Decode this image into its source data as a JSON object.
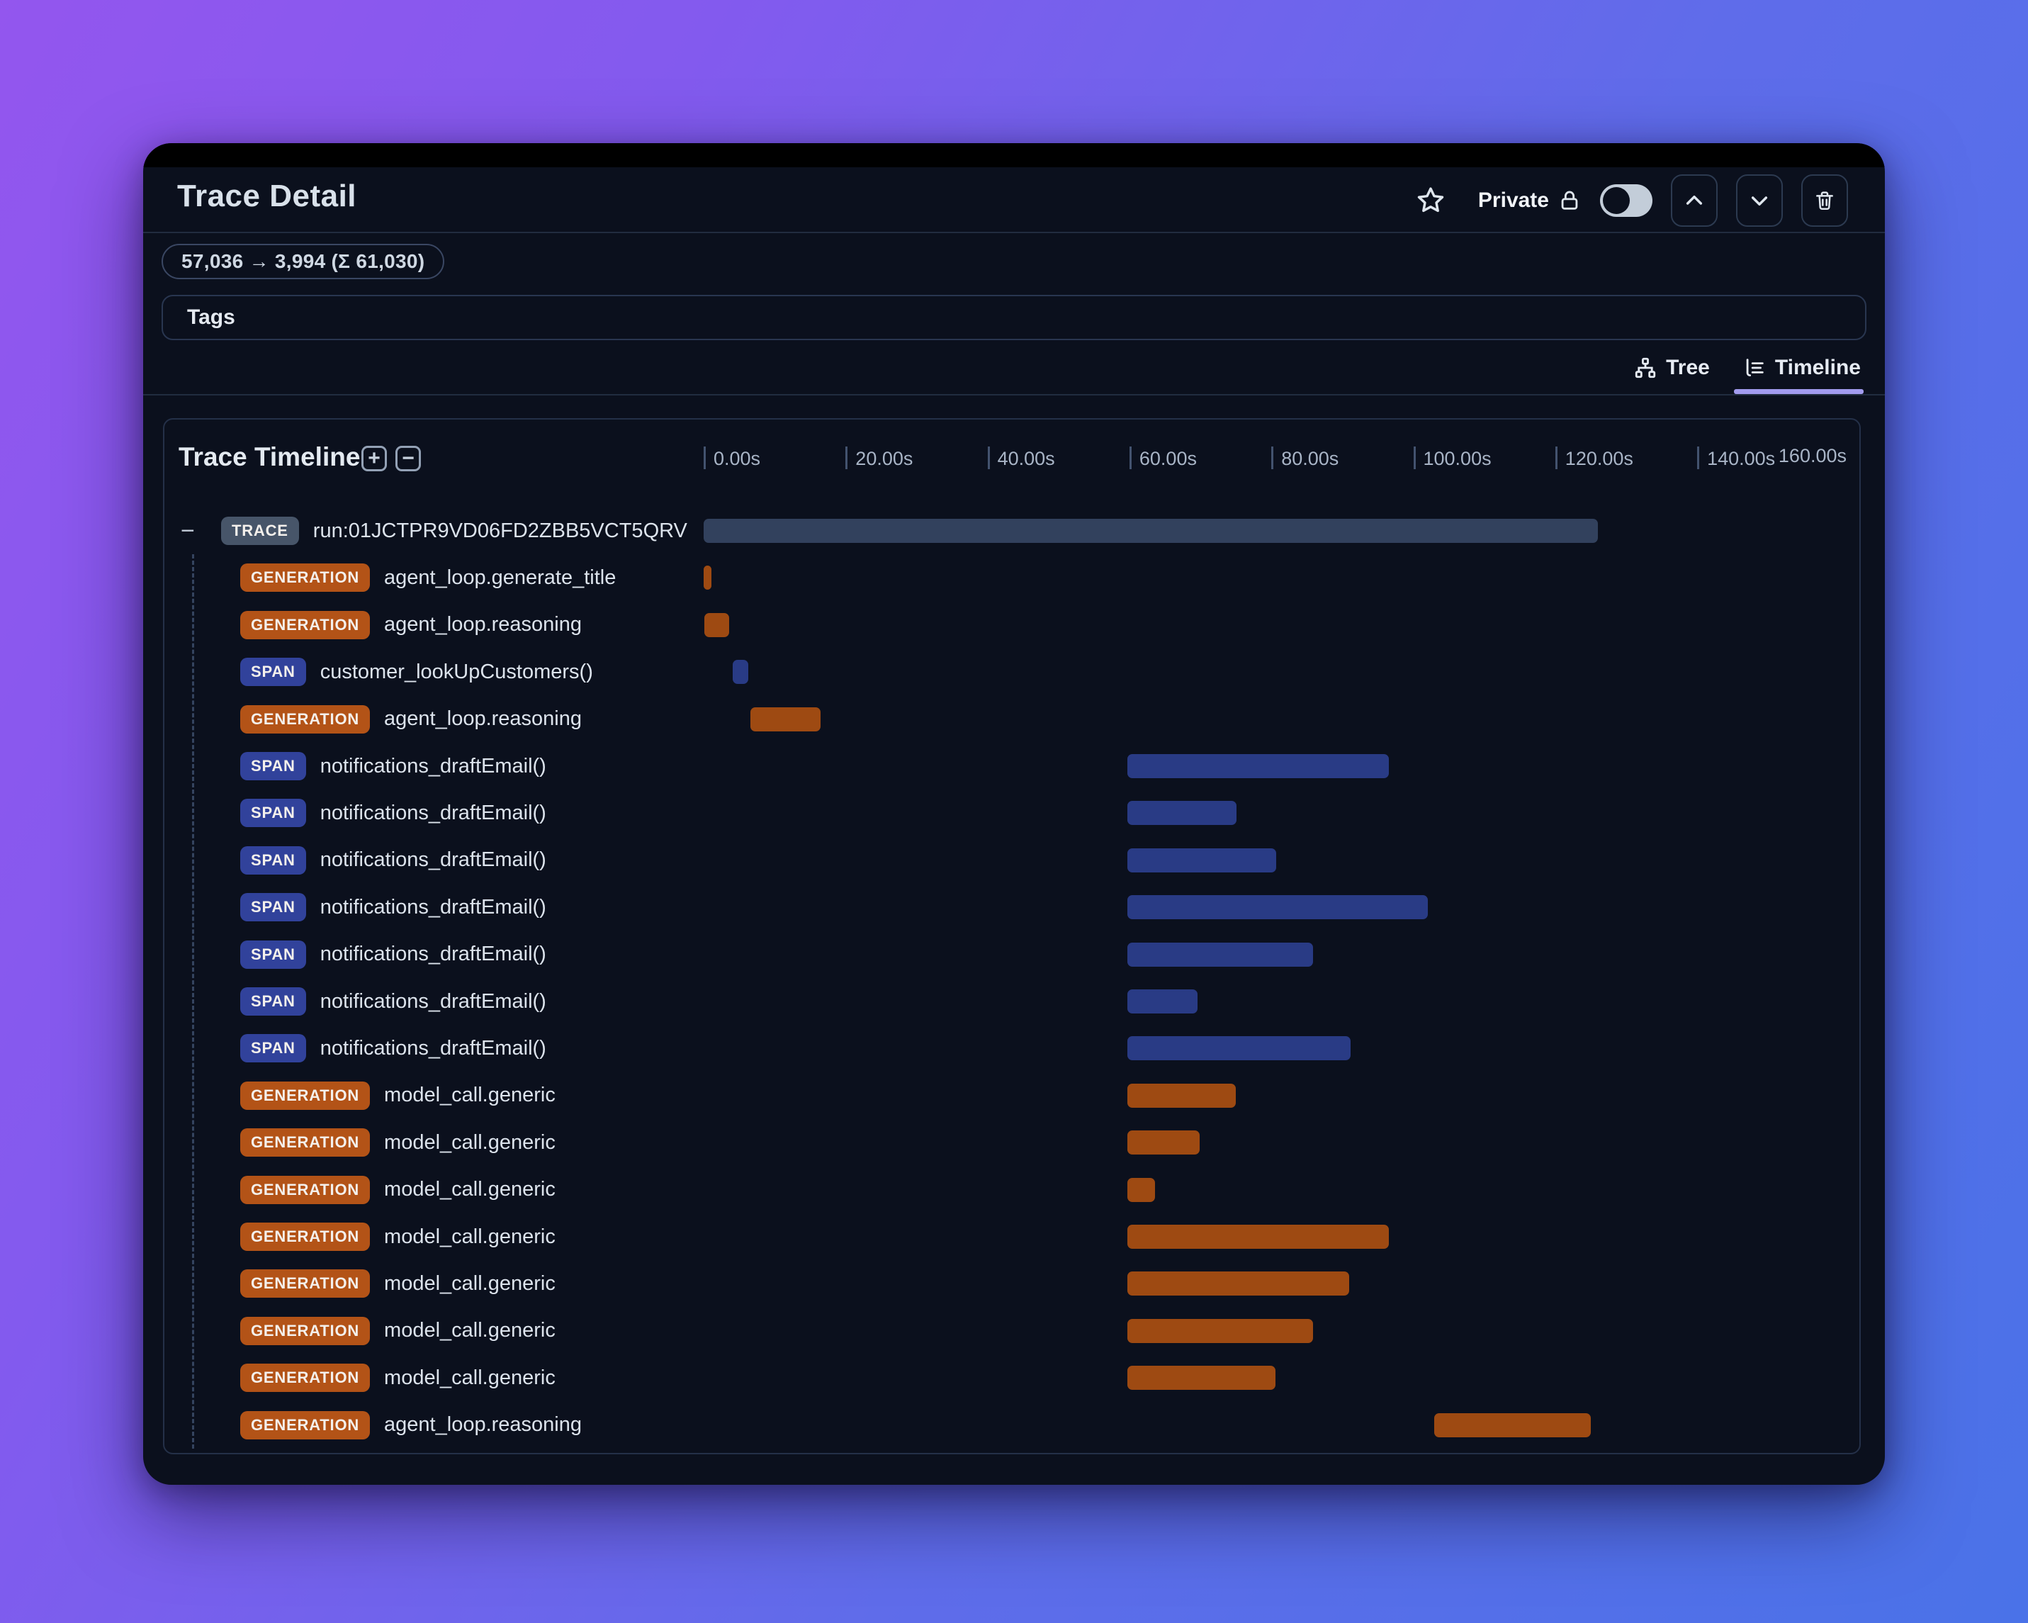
{
  "header": {
    "title": "Trace Detail",
    "privacy_label": "Private",
    "token_usage": "57,036 → 3,994 (Σ 61,030)",
    "tags_label": "Tags"
  },
  "view_tabs": [
    {
      "label": "Tree",
      "icon": "tree-icon",
      "active": false
    },
    {
      "label": "Timeline",
      "icon": "timeline-icon",
      "active": true
    }
  ],
  "timeline": {
    "title": "Trace Timeline",
    "zoom_in_label": "+",
    "zoom_out_label": "−",
    "collapse_glyph": "−",
    "axis_ticks": [
      {
        "seconds": 0,
        "label": "0.00s"
      },
      {
        "seconds": 20,
        "label": "20.00s"
      },
      {
        "seconds": 40,
        "label": "40.00s"
      },
      {
        "seconds": 60,
        "label": "60.00s"
      },
      {
        "seconds": 80,
        "label": "80.00s"
      },
      {
        "seconds": 100,
        "label": "100.00s"
      },
      {
        "seconds": 120,
        "label": "120.00s"
      },
      {
        "seconds": 140,
        "label": "140.00s"
      }
    ],
    "axis_end_label": "160.00s",
    "rows": [
      {
        "type": "TRACE",
        "label": "run:01JCTPR9VD06FD2ZBB5VCT5QRV",
        "start": 0,
        "end": 126.0
      },
      {
        "type": "GENERATION",
        "label": "agent_loop.generate_title",
        "start": 0,
        "end": 1.1
      },
      {
        "type": "GENERATION",
        "label": "agent_loop.reasoning",
        "start": 0.1,
        "end": 3.6
      },
      {
        "type": "SPAN",
        "label": "customer_lookUpCustomers()",
        "start": 4.1,
        "end": 6.3
      },
      {
        "type": "GENERATION",
        "label": "agent_loop.reasoning",
        "start": 6.6,
        "end": 16.5
      },
      {
        "type": "SPAN",
        "label": "notifications_draftEmail()",
        "start": 59.7,
        "end": 96.6
      },
      {
        "type": "SPAN",
        "label": "notifications_draftEmail()",
        "start": 59.7,
        "end": 75.1
      },
      {
        "type": "SPAN",
        "label": "notifications_draftEmail()",
        "start": 59.7,
        "end": 80.7
      },
      {
        "type": "SPAN",
        "label": "notifications_draftEmail()",
        "start": 59.7,
        "end": 102.0
      },
      {
        "type": "SPAN",
        "label": "notifications_draftEmail()",
        "start": 59.7,
        "end": 85.9
      },
      {
        "type": "SPAN",
        "label": "notifications_draftEmail()",
        "start": 59.7,
        "end": 69.6
      },
      {
        "type": "SPAN",
        "label": "notifications_draftEmail()",
        "start": 59.7,
        "end": 91.2
      },
      {
        "type": "GENERATION",
        "label": "model_call.generic",
        "start": 59.7,
        "end": 75.0
      },
      {
        "type": "GENERATION",
        "label": "model_call.generic",
        "start": 59.7,
        "end": 69.9
      },
      {
        "type": "GENERATION",
        "label": "model_call.generic",
        "start": 59.7,
        "end": 63.6
      },
      {
        "type": "GENERATION",
        "label": "model_call.generic",
        "start": 59.7,
        "end": 96.6
      },
      {
        "type": "GENERATION",
        "label": "model_call.generic",
        "start": 59.7,
        "end": 91.0
      },
      {
        "type": "GENERATION",
        "label": "model_call.generic",
        "start": 59.7,
        "end": 85.9
      },
      {
        "type": "GENERATION",
        "label": "model_call.generic",
        "start": 59.7,
        "end": 80.6
      },
      {
        "type": "GENERATION",
        "label": "agent_loop.reasoning",
        "start": 102.9,
        "end": 125.0
      }
    ]
  },
  "colors": {
    "accent_tab_underline": "#a29bee",
    "trace_badge": "#475569",
    "trace_bar": "#32415d",
    "generation_badge": "#b35317",
    "generation_bar": "#9e4a12",
    "span_badge": "#31429b",
    "span_bar": "#293b85",
    "window_bg": "#0b101d",
    "titlebar_bg": "#000000"
  }
}
